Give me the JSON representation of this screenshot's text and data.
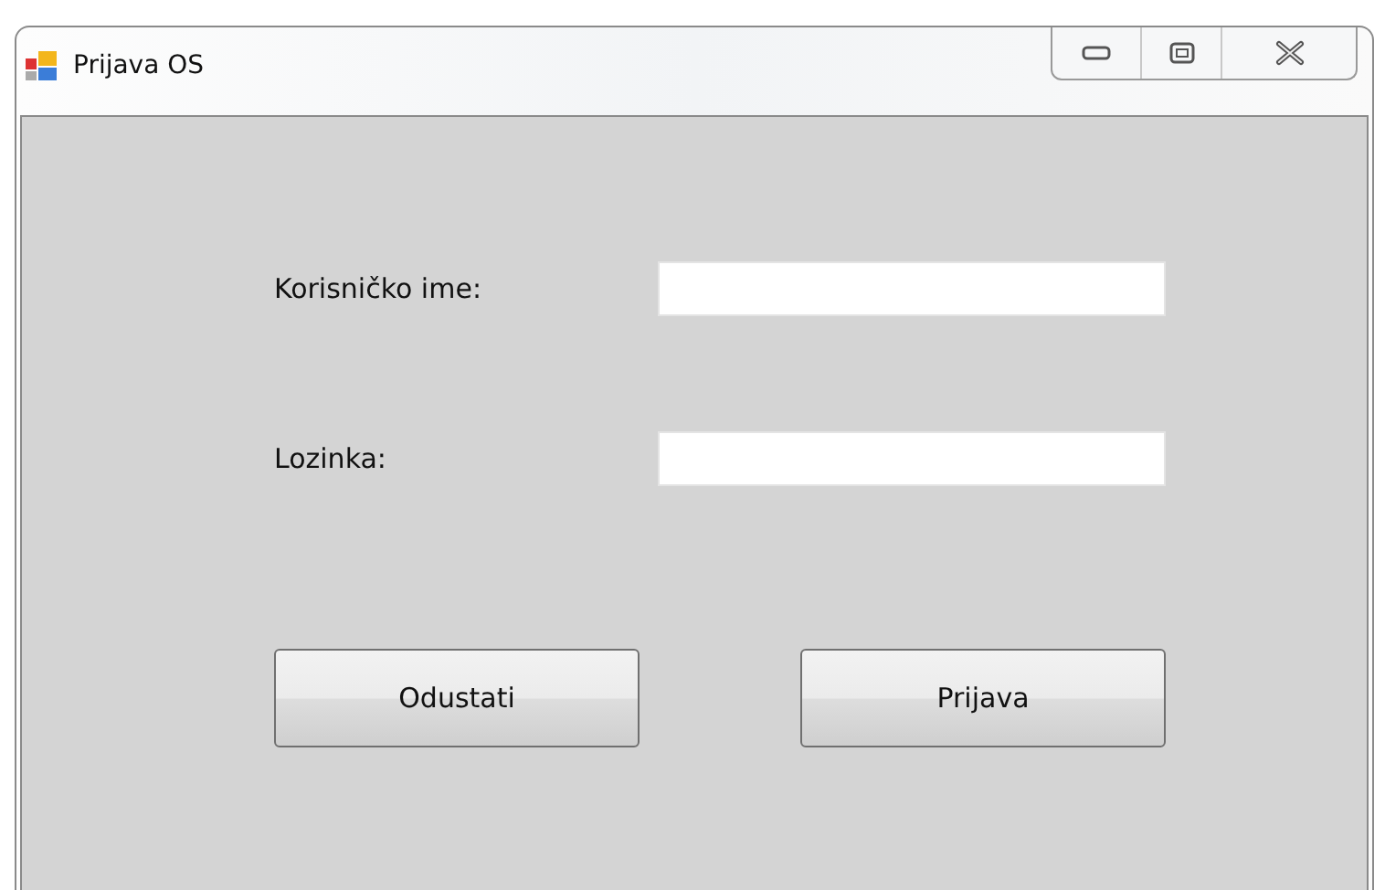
{
  "window": {
    "title": "Prijava OS"
  },
  "fields": [
    {
      "label": "Korisničko ime:"
    },
    {
      "label": "Lozinka:"
    }
  ],
  "buttons": [
    "Odustati",
    "Prijava"
  ]
}
